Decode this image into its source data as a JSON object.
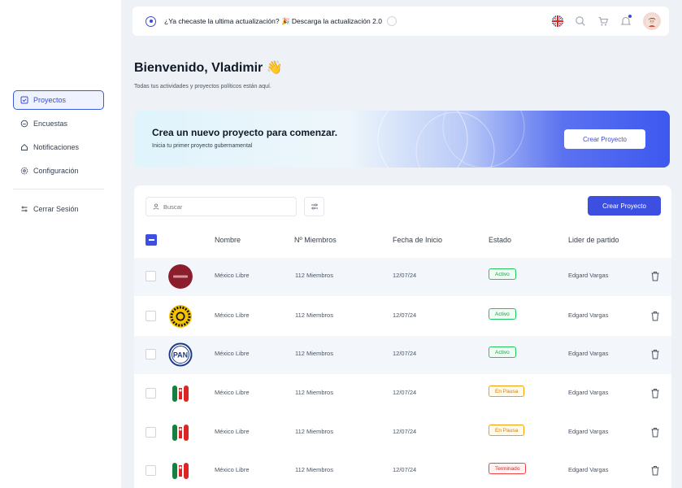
{
  "sidebar": {
    "items": [
      {
        "label": "Proyectos",
        "icon": "project-icon"
      },
      {
        "label": "Encuestas",
        "icon": "survey-icon"
      },
      {
        "label": "Notificaciones",
        "icon": "bell-icon"
      },
      {
        "label": "Configuración",
        "icon": "gear-icon"
      }
    ],
    "logout": "Cerrar Sesión"
  },
  "topbar": {
    "announcement": "¿Ya checaste la ultima actualización? 🎉 Descarga la actualización 2.0",
    "icons": [
      "uk-flag-icon",
      "search-icon",
      "cart-icon",
      "bell-icon",
      "avatar"
    ]
  },
  "welcome": {
    "title": "Bienvenido, Vladimir 👋",
    "subtitle": "Todas tus actividades y proyectos políticos están aquí."
  },
  "banner": {
    "title": "Crea un nuevo proyecto para comenzar.",
    "subtitle": "Inicia tu primer proyecto gubernamental",
    "button": "Crear Proyecto"
  },
  "table": {
    "search_placeholder": "Buscar",
    "create_button": "Crear Proyecto",
    "columns": [
      "Nombre",
      "Nº Miembros",
      "Fecha de Inicio",
      "Estado",
      "Lider de partido"
    ],
    "rows": [
      {
        "logo": "mexico-libre-logo",
        "name": "México Libre",
        "members": "112 Miembros",
        "date": "12/07/24",
        "status": "Activo",
        "status_kind": "active",
        "leader": "Edgard Vargas"
      },
      {
        "logo": "prd-sun-logo",
        "name": "México Libre",
        "members": "112 Miembros",
        "date": "12/07/24",
        "status": "Activo",
        "status_kind": "active",
        "leader": "Edgard Vargas"
      },
      {
        "logo": "pan-logo",
        "name": "México Libre",
        "members": "112 Miembros",
        "date": "12/07/24",
        "status": "Activo",
        "status_kind": "active",
        "leader": "Edgard Vargas"
      },
      {
        "logo": "pri-logo",
        "name": "México Libre",
        "members": "112 Miembros",
        "date": "12/07/24",
        "status": "En Pausa",
        "status_kind": "pause",
        "leader": "Edgard Vargas"
      },
      {
        "logo": "pri-logo",
        "name": "México Libre",
        "members": "112 Miembros",
        "date": "12/07/24",
        "status": "En Pausa",
        "status_kind": "pause",
        "leader": "Edgard Vargas"
      },
      {
        "logo": "pri-logo",
        "name": "México Libre",
        "members": "112 Miembros",
        "date": "12/07/24",
        "status": "Terminado",
        "status_kind": "done",
        "leader": "Edgard Vargas"
      }
    ]
  },
  "colors": {
    "accent": "#3d4fe0",
    "active": "#22c55e",
    "pause": "#f59e0b",
    "done": "#ef4444"
  }
}
